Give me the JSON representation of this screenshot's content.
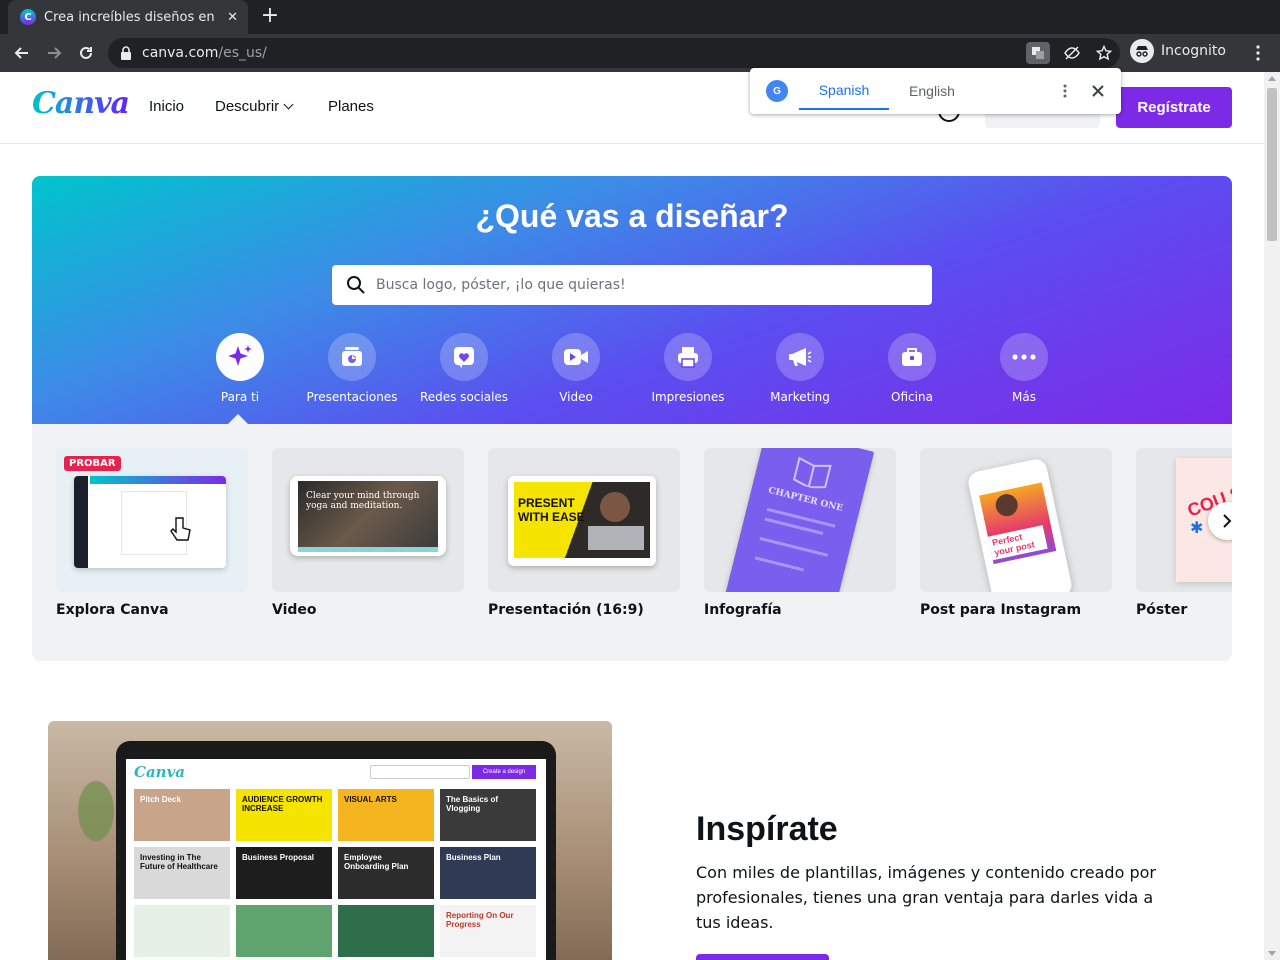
{
  "browser": {
    "tab_title": "Crea increíbles diseños en",
    "url_host": "canva.com",
    "url_path": "/es_us/",
    "profile_label": "Incognito"
  },
  "translate_popup": {
    "source_lang": "Spanish",
    "target_lang": "English"
  },
  "site": {
    "logo": "Canva",
    "nav": [
      "Inicio",
      "Descubrir",
      "Planes"
    ],
    "signup_label": "Regístrate"
  },
  "hero": {
    "title": "¿Qué vas a diseñar?",
    "search_placeholder": "Busca logo, póster, ¡lo que quieras!",
    "categories": [
      {
        "label": "Para ti",
        "icon": "sparkle-icon"
      },
      {
        "label": "Presentaciones",
        "icon": "presentation-icon"
      },
      {
        "label": "Redes sociales",
        "icon": "heart-icon"
      },
      {
        "label": "Video",
        "icon": "video-icon"
      },
      {
        "label": "Impresiones",
        "icon": "printer-icon"
      },
      {
        "label": "Marketing",
        "icon": "megaphone-icon"
      },
      {
        "label": "Oficina",
        "icon": "briefcase-icon"
      },
      {
        "label": "Más",
        "icon": "more-icon"
      }
    ]
  },
  "design_types": {
    "badge": "PROBAR",
    "cards": [
      {
        "label": "Explora Canva"
      },
      {
        "label": "Video",
        "thumb_text": "Clear your mind through yoga and meditation."
      },
      {
        "label": "Presentación (16:9)",
        "thumb_text": "PRESENT WITH EASE"
      },
      {
        "label": "Infografía",
        "thumb_text": "CHAPTER ONE"
      },
      {
        "label": "Post para Instagram",
        "thumb_text": "Perfect your post"
      },
      {
        "label": "Póster"
      }
    ]
  },
  "inspire": {
    "title": "Inspírate",
    "text": "Con miles de plantillas, imágenes y contenido creado por profesionales, tienes una gran ventaja para darles vida a tus ideas.",
    "mockup_logo": "Canva",
    "mockup_button": "Create a design",
    "mockup_tiles": [
      "Pitch Deck",
      "AUDIENCE GROWTH INCREASE",
      "VISUAL ARTS",
      "The Basics of Vlogging",
      "Investing in The Future of Healthcare",
      "Business Proposal",
      "Employee Onboarding Plan",
      "Business Plan",
      "",
      "",
      "",
      "Reporting On Our Progress"
    ]
  },
  "colors": {
    "brand_purple": "#7d2ae8",
    "brand_teal": "#00c4cc",
    "badge_red": "#e6224f",
    "chrome_dark": "#35363a"
  }
}
